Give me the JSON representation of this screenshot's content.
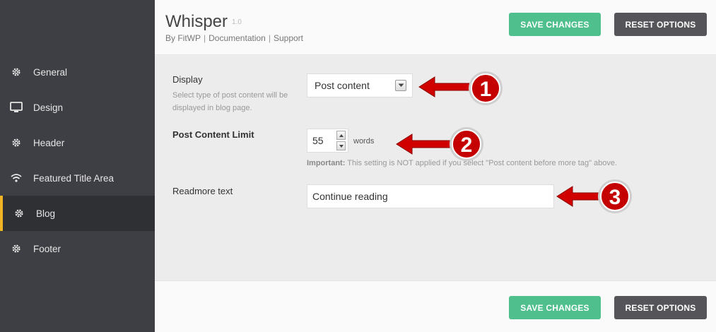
{
  "sidebar": {
    "items": [
      {
        "label": "General",
        "icon": "gear-icon"
      },
      {
        "label": "Design",
        "icon": "monitor-icon"
      },
      {
        "label": "Header",
        "icon": "gear-icon"
      },
      {
        "label": "Featured Title Area",
        "icon": "wifi-icon"
      },
      {
        "label": "Blog",
        "icon": "gear-icon",
        "active": true
      },
      {
        "label": "Footer",
        "icon": "gear-icon"
      }
    ]
  },
  "header": {
    "title": "Whisper",
    "version": "1.0",
    "by": "By FitWP",
    "documentation": "Documentation",
    "support": "Support",
    "sep": "|"
  },
  "actions": {
    "save_label": "SAVE CHANGES",
    "reset_label": "RESET OPTIONS"
  },
  "settings": {
    "display": {
      "label": "Display",
      "description": "Select type of post content will be displayed in blog page.",
      "value": "Post content"
    },
    "limit": {
      "label": "Post Content Limit",
      "value": "55",
      "unit": "words",
      "note_bold": "Important:",
      "note": " This setting is NOT applied if you select \"Post content before more tag\" above."
    },
    "readmore": {
      "label": "Readmore text",
      "value": "Continue reading"
    }
  },
  "annotations": [
    "1",
    "2",
    "3"
  ],
  "colors": {
    "accent_green": "#4fc08d",
    "reset_dark": "#555559",
    "sidebar_bg": "#3e3f44",
    "active_bar": "#f0b323",
    "arrow_red": "#d10000"
  }
}
